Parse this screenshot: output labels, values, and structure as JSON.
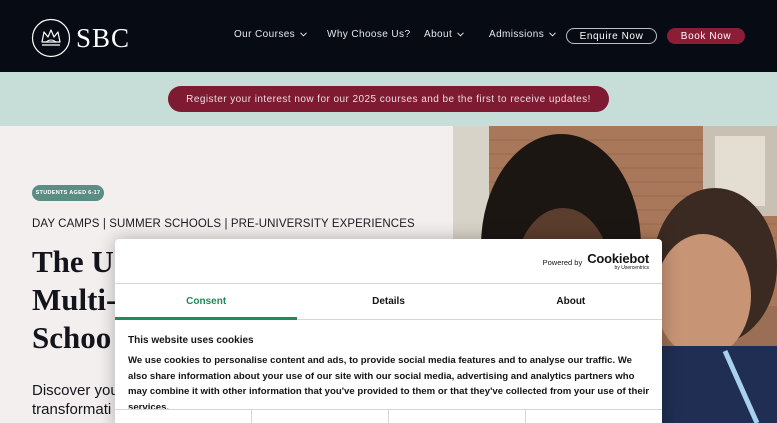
{
  "brand": {
    "name": "SBC",
    "logo_icon": "crown-icon"
  },
  "nav": {
    "items": [
      {
        "label": "Our Courses",
        "has_dropdown": true
      },
      {
        "label": "Why Choose Us?",
        "has_dropdown": false
      },
      {
        "label": "About",
        "has_dropdown": true
      },
      {
        "label": "Admissions",
        "has_dropdown": true
      }
    ],
    "enquire_label": "Enquire Now",
    "book_label": "Book Now"
  },
  "banner": {
    "text": "Register your interest now for our 2025 courses and be the first to receive updates!"
  },
  "hero": {
    "badge": "STUDENTS AGED 6-17",
    "subheading": "DAY CAMPS | SUMMER SCHOOLS | PRE-UNIVERSITY EXPERIENCES",
    "heading_lines": [
      "The U",
      "Multi-",
      "Schoo"
    ],
    "description_lines": [
      "Discover you",
      "transformati"
    ]
  },
  "cookie_dialog": {
    "powered_by": "Powered by",
    "brand_name": "Cookiebot",
    "brand_by": "by Usercentrics",
    "tabs": [
      {
        "label": "Consent",
        "active": true
      },
      {
        "label": "Details",
        "active": false
      },
      {
        "label": "About",
        "active": false
      }
    ],
    "title": "This website uses cookies",
    "body": "We use cookies to personalise content and ads, to provide social media features and to analyse our traffic. We also share information about your use of our site with our social media, advertising and analytics partners who may combine it with other information that you've provided to them or that they've collected from your use of their services."
  },
  "colors": {
    "nav_bg": "#070b14",
    "banner_bg": "#c7ddd8",
    "accent": "#8b1d36",
    "badge": "#5a8d83",
    "cookie_active": "#1e8b5a"
  }
}
